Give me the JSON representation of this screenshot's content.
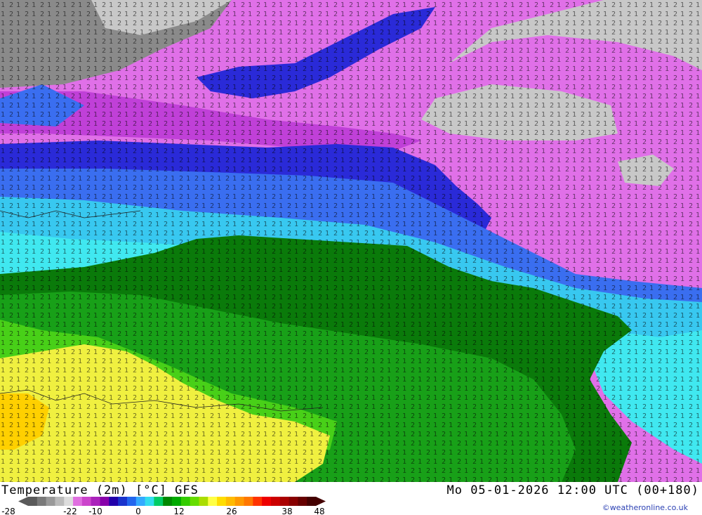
{
  "title": {
    "left": "Temperature (2m) [°C] GFS",
    "right": "Mo 05-01-2026 12:00 UTC (00+180)"
  },
  "credit": "©weatheronline.co.uk",
  "legend": {
    "tick_labels": [
      "-28",
      "-22",
      "-10",
      "0",
      "12",
      "26",
      "38",
      "48"
    ],
    "colors": [
      "#5a5a5a",
      "#7a7a7a",
      "#9a9a9a",
      "#bbbbbb",
      "#dddddd",
      "#e070e0",
      "#cc44cc",
      "#aa22bb",
      "#8800aa",
      "#2200aa",
      "#1a33cc",
      "#2266ee",
      "#33aaff",
      "#33ddee",
      "#00cc66",
      "#008800",
      "#00aa00",
      "#33cc00",
      "#66dd00",
      "#aadd00",
      "#ffff44",
      "#ffdd00",
      "#ffbb00",
      "#ff9900",
      "#ff7700",
      "#ff3300",
      "#ee0000",
      "#cc0000",
      "#aa0000",
      "#880000",
      "#660000",
      "#440000"
    ]
  },
  "map_colors": {
    "dark_gray": "#8a8a8a",
    "light_gray": "#c8c8c8",
    "magenta": "#e070e8",
    "violet": "#c040d8",
    "blue_dark": "#2a2ad8",
    "blue": "#3a6ef0",
    "light_blue": "#38c8f0",
    "cyan": "#40e8f0",
    "dark_green": "#0a7a0a",
    "green": "#18a018",
    "bright_green": "#48d018",
    "yellow": "#f0f040"
  }
}
